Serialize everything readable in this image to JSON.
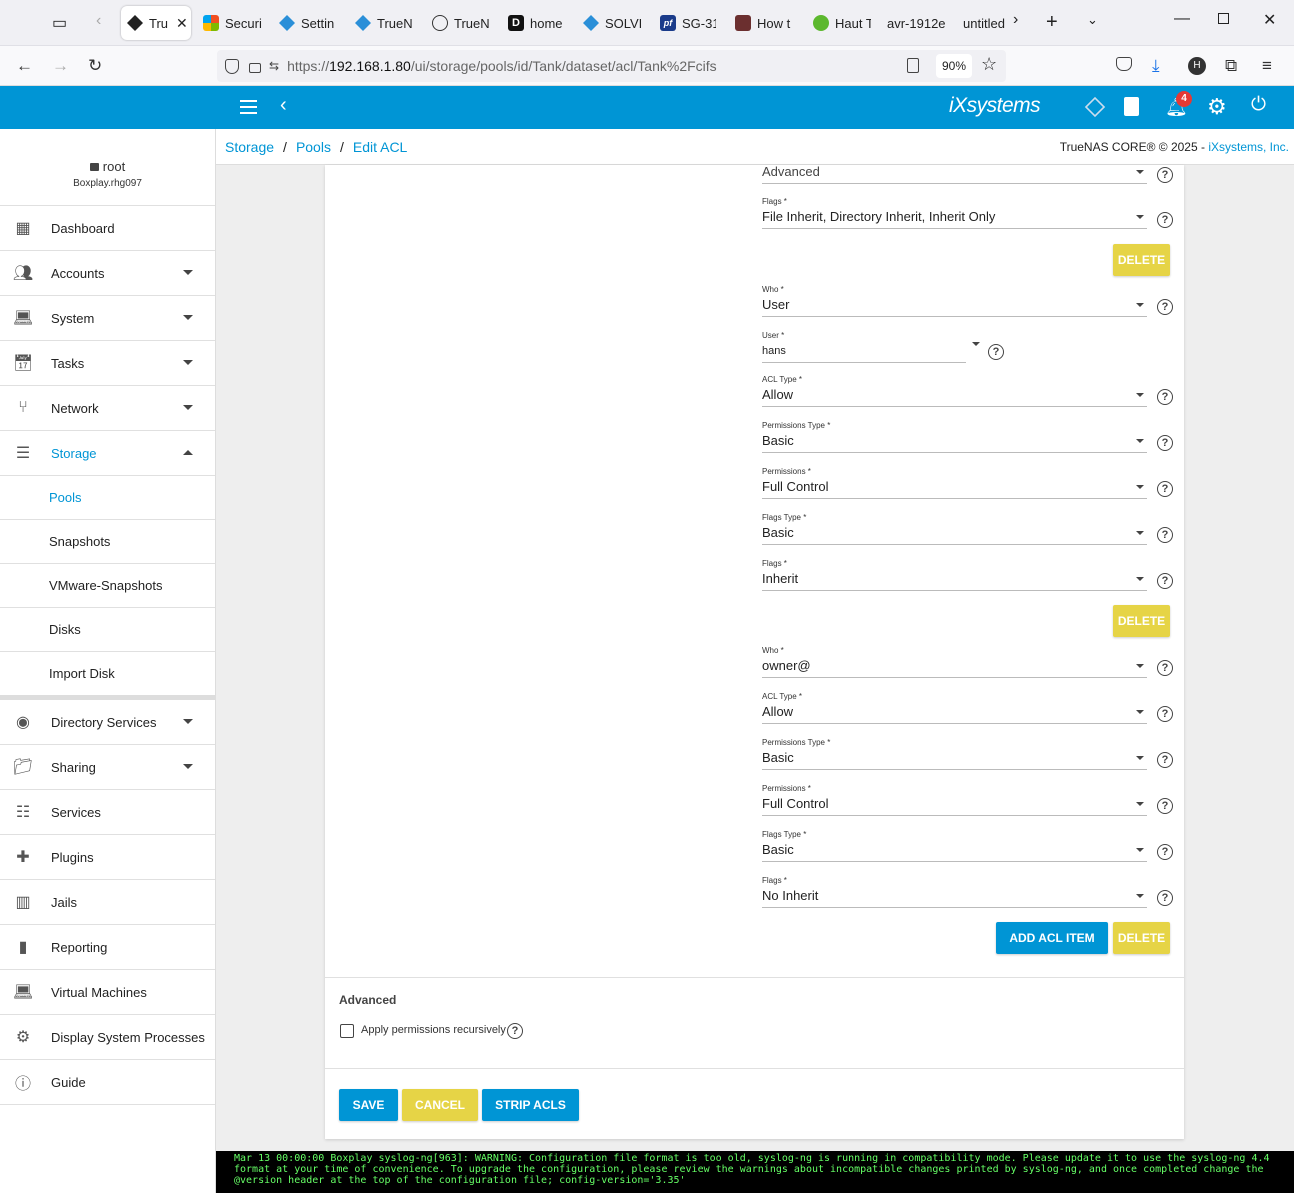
{
  "browser": {
    "tabs": [
      {
        "label": "Tru",
        "active": true
      },
      {
        "label": "Securi"
      },
      {
        "label": "Settin"
      },
      {
        "label": "TrueN"
      },
      {
        "label": "TrueN"
      },
      {
        "label": "home"
      },
      {
        "label": "SOLVE"
      },
      {
        "label": "SG-31"
      },
      {
        "label": "How t"
      },
      {
        "label": "Haut T"
      },
      {
        "label": "avr-1912e"
      },
      {
        "label": "untitled"
      }
    ],
    "url": {
      "prefix": "https://",
      "host": "192.168.1.80",
      "path": "/ui/storage/pools/id/Tank/dataset/acl/Tank%2Fcifs"
    },
    "zoom": "90%",
    "profile_initial": "H"
  },
  "topbar": {
    "brand": "iXsystems",
    "notification_count": "4",
    "accent": "#0095d5"
  },
  "user": {
    "name": "root",
    "host": "Boxplay.rhg097"
  },
  "nav": [
    {
      "label": "Dashboard",
      "icon": "dashboard-icon"
    },
    {
      "label": "Accounts",
      "icon": "accounts-icon"
    },
    {
      "label": "System",
      "icon": "system-icon"
    },
    {
      "label": "Tasks",
      "icon": "tasks-icon"
    },
    {
      "label": "Network",
      "icon": "network-icon"
    },
    {
      "label": "Storage",
      "icon": "storage-icon"
    }
  ],
  "storage_sub": [
    "Pools",
    "Snapshots",
    "VMware-Snapshots",
    "Disks",
    "Import Disk"
  ],
  "nav2": [
    {
      "label": "Directory Services",
      "icon": "directory-services-icon"
    },
    {
      "label": "Sharing",
      "icon": "sharing-icon"
    },
    {
      "label": "Services",
      "icon": "services-icon"
    },
    {
      "label": "Plugins",
      "icon": "plugins-icon"
    },
    {
      "label": "Jails",
      "icon": "jails-icon"
    },
    {
      "label": "Reporting",
      "icon": "reporting-icon"
    },
    {
      "label": "Virtual Machines",
      "icon": "virtual-machines-icon"
    },
    {
      "label": "Display System Processes",
      "icon": "processes-icon"
    },
    {
      "label": "Guide",
      "icon": "guide-icon"
    }
  ],
  "breadcrumb": {
    "storage": "Storage",
    "sep": "/",
    "pools": "Pools",
    "current": "Edit ACL"
  },
  "copyright": {
    "text": "TrueNAS CORE® © 2025 - ",
    "link": "iXsystems, Inc."
  },
  "acl": {
    "item1": {
      "flags_type": "Advanced",
      "flags_label": "Flags *",
      "flags": "File Inherit, Directory Inherit, Inherit Only"
    },
    "item2": {
      "who_label": "Who *",
      "who": "User",
      "user_label": "User *",
      "user": "hans",
      "acl_type_label": "ACL Type *",
      "acl_type": "Allow",
      "perm_type_label": "Permissions Type *",
      "perm_type": "Basic",
      "perm_label": "Permissions *",
      "perm": "Full Control",
      "flags_type_label": "Flags Type *",
      "flags_type": "Basic",
      "flags_label": "Flags *",
      "flags": "Inherit"
    },
    "item3": {
      "who_label": "Who *",
      "who": "owner@",
      "acl_type_label": "ACL Type *",
      "acl_type": "Allow",
      "perm_type_label": "Permissions Type *",
      "perm_type": "Basic",
      "perm_label": "Permissions *",
      "perm": "Full Control",
      "flags_type_label": "Flags Type *",
      "flags_type": "Basic",
      "flags_label": "Flags *",
      "flags": "No Inherit"
    },
    "delete_label": "DELETE",
    "add_label": "ADD ACL ITEM"
  },
  "advanced": {
    "title": "Advanced",
    "recursive_label": "Apply permissions recursively"
  },
  "actions": {
    "save": "SAVE",
    "cancel": "CANCEL",
    "strip": "STRIP ACLS"
  },
  "console": {
    "lines": [
      "Mar 13 00:00:00 Boxplay syslog-ng[963]: WARNING: Configuration file format is too old, syslog-ng is running in compatibility mode. Please update it to use the syslog-ng 4.4",
      "format at your time of convenience. To upgrade the configuration, please review the warnings about incompatible changes printed by syslog-ng, and once completed change the",
      "@version header at the top of the configuration file; config-version='3.35'"
    ]
  }
}
